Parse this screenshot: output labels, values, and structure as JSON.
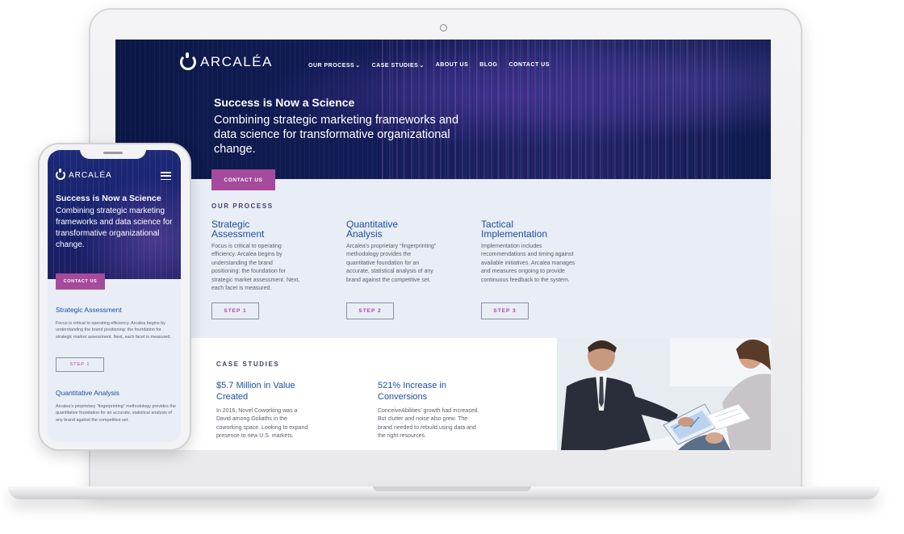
{
  "desktop": {
    "brand": "ARCALÉA",
    "nav": [
      {
        "label": "OUR PROCESS",
        "chevron": "⌄"
      },
      {
        "label": "CASE STUDIES",
        "chevron": "⌄"
      },
      {
        "label": "ABOUT US",
        "chevron": ""
      },
      {
        "label": "BLOG",
        "chevron": ""
      },
      {
        "label": "CONTACT US",
        "chevron": ""
      }
    ],
    "hero": {
      "title": "Success is Now a Science",
      "subtitle": "Combining strategic marketing frameworks and data science for transformative organizational change.",
      "cta": "CONTACT US"
    },
    "process": {
      "label": "OUR PROCESS",
      "columns": [
        {
          "title": "Strategic Assessment",
          "text": "Focus is critical to operating efficiency. Arcalea begins by understanding the brand positioning: the foundation for strategic market assessment. Next, each facet is measured.",
          "button": "STEP 1"
        },
        {
          "title": "Quantitative Analysis",
          "text": "Arcalea’s proprietary “fingerprinting” methodology provides the quantitative foundation for an accurate, statistical analysis of any brand against the competitive set.",
          "button": "STEP 2"
        },
        {
          "title": "Tactical Implementation",
          "text": "Implementation includes recommendations and timing against available initiatives. Arcalea manages and measures ongoing to provide continuous feedback to the system.",
          "button": "STEP 3"
        }
      ]
    },
    "case_studies": {
      "label": "CASE STUDIES",
      "items": [
        {
          "title": "$5.7 Million in Value Created",
          "text": "In 2016, Novel Coworking was a David among Goliaths in the coworking space. Looking to expand presence to new U.S. markets."
        },
        {
          "title": "521% Increase in Conversions",
          "text": "ConceiveAbilities’ growth had increased. But clutter and noise also grew. The brand needed to rebuild using data and the right resources."
        }
      ]
    }
  },
  "mobile": {
    "brand": "ARCALÉA",
    "menu_icon": "hamburger-icon",
    "hero": {
      "title": "Success is Now a Science",
      "subtitle": "Combining strategic marketing frameworks and data science for transformative organizational change.",
      "cta": "CONTACT US"
    },
    "sections": [
      {
        "title": "Strategic Assessment",
        "text": "Focus is critical to operating efficiency. Arcalea begins by understanding the brand positioning: the foundation for strategic market assessment. Next, each facet is measured.",
        "button": "STEP 1"
      },
      {
        "title": "Quantitative Analysis",
        "text": "Arcalea’s proprietary “fingerprinting” methodology provides the quantitative foundation for an accurate, statistical analysis of any brand against the competitive set."
      }
    ]
  },
  "colors": {
    "navy": "#0b1846",
    "accent_magenta": "#a54a9c",
    "heading_blue": "#1f4fa0",
    "process_bg": "#e9edf5"
  }
}
